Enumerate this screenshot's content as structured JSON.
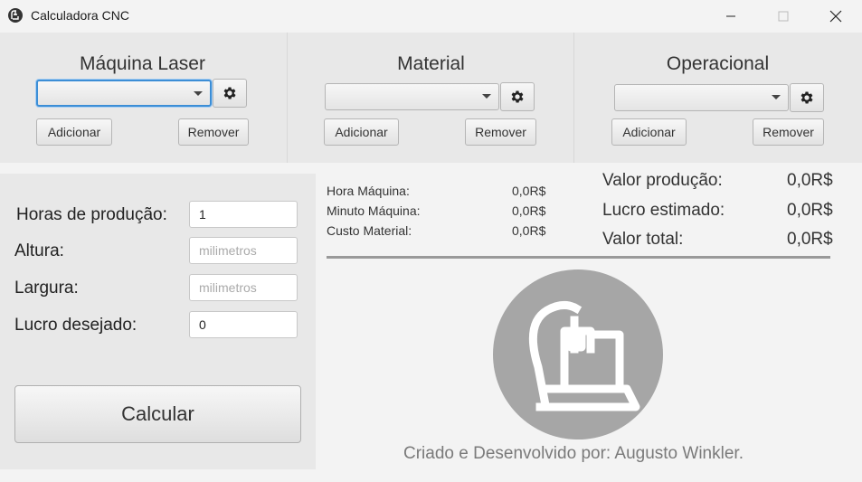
{
  "window": {
    "title": "Calculadora CNC",
    "icons": {
      "app": "cnc-logo-icon",
      "minimize": "minimize-icon",
      "maximize": "maximize-icon",
      "close": "close-icon"
    }
  },
  "groups": [
    {
      "title": "Máquina Laser",
      "add_label": "Adicionar",
      "remove_label": "Remover",
      "selected": ""
    },
    {
      "title": "Material",
      "add_label": "Adicionar",
      "remove_label": "Remover",
      "selected": ""
    },
    {
      "title": "Operacional",
      "add_label": "Adicionar",
      "remove_label": "Remover",
      "selected": ""
    }
  ],
  "form": {
    "horas_label": "Horas de produção:",
    "horas_value": "1",
    "altura_label": "Altura:",
    "altura_placeholder": "milimetros",
    "largura_label": "Largura:",
    "largura_placeholder": "milimetros",
    "lucro_label": "Lucro desejado:",
    "lucro_value": "0",
    "calc_label": "Calcular"
  },
  "results": {
    "hora_maquina_label": "Hora Máquina:",
    "hora_maquina_value": "0,0R$",
    "minuto_maquina_label": "Minuto Máquina:",
    "minuto_maquina_value": "0,0R$",
    "custo_material_label": "Custo Material:",
    "custo_material_value": "0,0R$",
    "valor_producao_label": "Valor produção:",
    "valor_producao_value": "0,0R$",
    "lucro_estimado_label": "Lucro estimado:",
    "lucro_estimado_value": "0,0R$",
    "valor_total_label": "Valor total:",
    "valor_total_value": "0,0R$"
  },
  "credits": "Criado e Desenvolvido por: Augusto Winkler.",
  "colors": {
    "accent": "#3c8ed6",
    "logo": "#a6a6a6",
    "panel": "#e8e8e8",
    "background": "#f3f3f3"
  }
}
